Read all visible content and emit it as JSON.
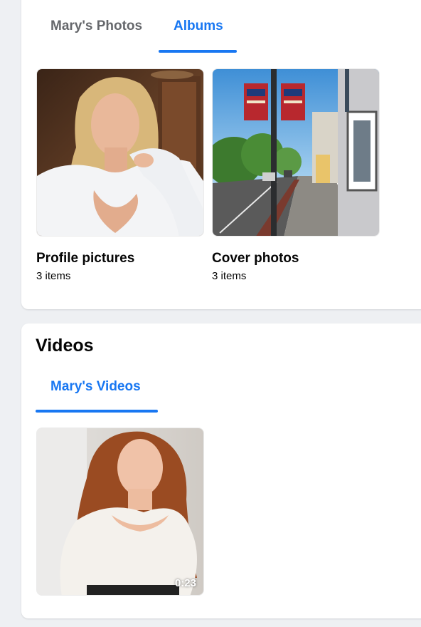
{
  "albums_section": {
    "tabs": [
      {
        "label": "Mary's Photos",
        "active": false
      },
      {
        "label": "Albums",
        "active": true
      }
    ],
    "albums": [
      {
        "title": "Profile pictures",
        "count": "3 items",
        "thumbnail": "portrait-photo"
      },
      {
        "title": "Cover photos",
        "count": "3 items",
        "thumbnail": "street-photo"
      }
    ]
  },
  "videos_section": {
    "title": "Videos",
    "tabs": [
      {
        "label": "Mary's Videos",
        "active": true
      }
    ],
    "videos": [
      {
        "duration": "0:23",
        "thumbnail": "portrait-video"
      }
    ]
  },
  "colors": {
    "accent": "#1877f2",
    "page_background": "#eef0f3",
    "card_background": "#ffffff",
    "muted_text": "#65676b"
  }
}
